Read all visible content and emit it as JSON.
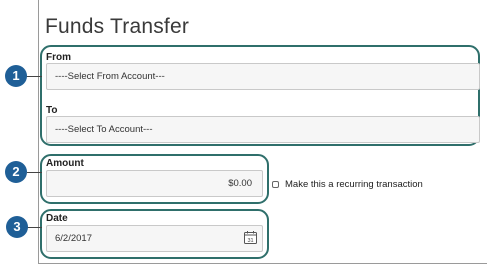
{
  "title": "Funds Transfer",
  "from": {
    "label": "From",
    "value": "----Select From Account---"
  },
  "to": {
    "label": "To",
    "value": "----Select To Account---"
  },
  "amount": {
    "label": "Amount",
    "value": "$0.00"
  },
  "recurring": {
    "label": "Make this a recurring transaction",
    "checked": false
  },
  "date": {
    "label": "Date",
    "value": "6/2/2017"
  },
  "calendar_icon": {
    "name": "calendar-icon",
    "day": "31"
  },
  "markers": [
    "1",
    "2",
    "3"
  ],
  "colors": {
    "marker": "#1f5f97",
    "callout": "#2f6f6b",
    "border": "#9a9a9a"
  }
}
